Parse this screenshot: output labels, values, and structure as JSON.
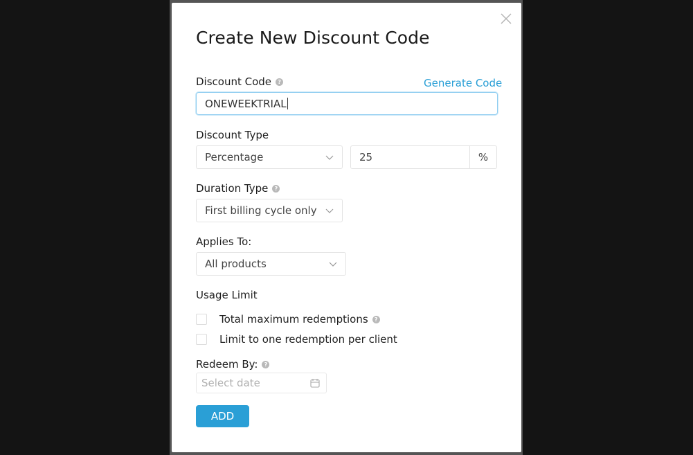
{
  "modal": {
    "title": "Create New Discount Code"
  },
  "discount_code": {
    "label": "Discount Code",
    "generate_link": "Generate Code",
    "value": "ONEWEEKTRIAL"
  },
  "discount_type": {
    "label": "Discount Type",
    "selected": "Percentage",
    "amount": "25",
    "unit": "%"
  },
  "duration_type": {
    "label": "Duration Type",
    "selected": "First billing cycle only"
  },
  "applies_to": {
    "label": "Applies To:",
    "selected": "All products"
  },
  "usage_limit": {
    "label": "Usage Limit",
    "options": [
      {
        "label": "Total maximum redemptions",
        "checked": false
      },
      {
        "label": "Limit to one redemption per client",
        "checked": false
      }
    ]
  },
  "redeem_by": {
    "label": "Redeem By:",
    "placeholder": "Select date"
  },
  "actions": {
    "add_label": "ADD"
  },
  "colors": {
    "accent": "#2a9fd6",
    "overlay": "#111111"
  },
  "icons": [
    "close-icon",
    "help-icon",
    "chevron-down-icon",
    "calendar-icon"
  ]
}
